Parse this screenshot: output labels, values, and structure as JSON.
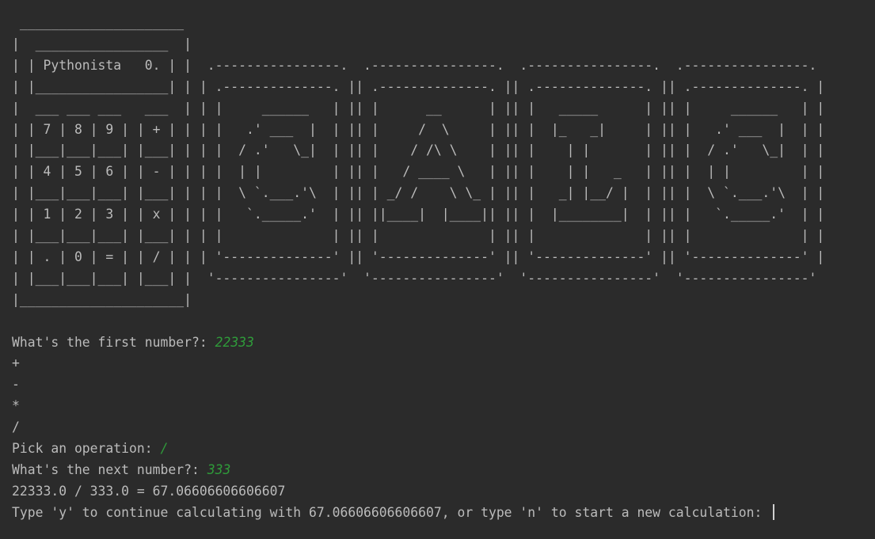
{
  "console": {
    "ascii_art": " _____________________\n|  _________________  |\n| | Pythonista   0. | |  .----------------.  .----------------.  .----------------.  .----------------.\n| |_________________| | | .--------------. || .--------------. || .--------------. || .--------------. |\n|  ___ ___ ___   ___  | | |     ______   | || |      __      | || |   _____      | || |     ______   | |\n| | 7 | 8 | 9 | | + | | | |   .' ___  |  | || |     /  \\     | || |  |_   _|     | || |   .' ___  |  | |\n| |___|___|___| |___| | | |  / .'   \\_|  | || |    / /\\ \\    | || |    | |       | || |  / .'   \\_|  | |\n| | 4 | 5 | 6 | | - | | | |  | |         | || |   / ____ \\   | || |    | |   _   | || |  | |         | |\n| |___|___|___| |___| | | |  \\ `.___.'\\  | || | _/ /    \\ \\_ | || |   _| |__/ |  | || |  \\ `.___.'\\  | |\n| | 1 | 2 | 3 | | x | | | |   `._____.'  | || ||____|  |____|| || |  |________|  | || |   `._____.'  | |\n| |___|___|___| |___| | | |              | || |              | || |              | || |              | |\n| | . | 0 | = | | / | | | '--------------' || '--------------' || '--------------' || '--------------' |\n| |___|___|___| |___| |  '----------------'  '----------------'  '----------------'  '----------------'\n|_____________________|",
    "first_prompt": "What's the first number?: ",
    "first_value": "22333",
    "op_plus": "+",
    "op_minus": "-",
    "op_multiply": "*",
    "op_divide": "/",
    "op_prompt": "Pick an operation: ",
    "op_value": "/",
    "next_prompt": "What's the next number?: ",
    "next_value": "333",
    "result_line": "22333.0 / 333.0 = 67.06606606606607",
    "continue_prompt": "Type 'y' to continue calculating with 67.06606606606607, or type 'n' to start a new calculation: "
  }
}
